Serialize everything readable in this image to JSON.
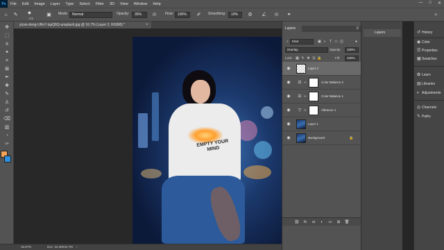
{
  "app": {
    "logo": "Ps"
  },
  "menu": [
    "File",
    "Edit",
    "Image",
    "Layer",
    "Type",
    "Select",
    "Filter",
    "3D",
    "View",
    "Window",
    "Help"
  ],
  "window_controls": {
    "minimize": "—",
    "maximize": "□",
    "close": "✕"
  },
  "options_bar": {
    "brush_size": "175",
    "mode_label": "Mode:",
    "mode_value": "Normal",
    "opacity_label": "Opacity:",
    "opacity_value": "35%",
    "flow_label": "Flow:",
    "flow_value": "100%",
    "smoothing_label": "Smoothing:",
    "smoothing_value": "10%"
  },
  "document_tab": {
    "title": "yican-deng-URn7-lupQ6Q-unsplash.jpg @ 16.7% (Layer 2, RGB/8) *",
    "close": "×"
  },
  "canvas": {
    "shirt_text": "EMPTY YOUR MIND"
  },
  "status_bar": {
    "zoom": "16.67%",
    "doc": "Doc: 34.3M/42.7M",
    "arrow": "›"
  },
  "layers_panel": {
    "tab_label": "Layers",
    "menu_icon": "≡",
    "kind_label": "Kind",
    "blend_mode": "Overlay",
    "opacity_label": "Opacity:",
    "opacity_value": "100%",
    "lock_label": "Lock:",
    "fill_label": "Fill:",
    "fill_value": "100%",
    "layers": [
      {
        "name": "Layer 2",
        "type": "pixel-empty",
        "selected": true
      },
      {
        "name": "Color Balance 2",
        "type": "color-balance"
      },
      {
        "name": "Color Balance 1",
        "type": "color-balance"
      },
      {
        "name": "Vibrance 1",
        "type": "vibrance"
      },
      {
        "name": "Layer 1",
        "type": "pixel-photo"
      },
      {
        "name": "Background",
        "type": "background"
      }
    ],
    "bottom_icons": [
      "link-icon",
      "fx-icon",
      "mask-icon",
      "adjustment-icon",
      "folder-icon",
      "new-layer-icon",
      "trash-icon"
    ],
    "bottom_glyphs": [
      "⛓",
      "fx",
      "◘",
      "◐",
      "▭",
      "⊞",
      "🗑"
    ]
  },
  "mid_panel": {
    "tab_label": "Layers"
  },
  "right_panel": {
    "items": [
      {
        "label": "History",
        "icon": "history-icon",
        "glyph": "↺"
      },
      {
        "label": "Color",
        "icon": "color-icon",
        "glyph": "◉"
      },
      {
        "label": "Properties",
        "icon": "properties-icon",
        "glyph": "☰"
      },
      {
        "label": "Swatches",
        "icon": "swatches-icon",
        "glyph": "▦"
      },
      {
        "label": "Learn",
        "icon": "learn-icon",
        "glyph": "✿"
      },
      {
        "label": "Libraries",
        "icon": "libraries-icon",
        "glyph": "▤"
      },
      {
        "label": "Adjustments",
        "icon": "adjustments-icon",
        "glyph": "◐"
      },
      {
        "label": "Channels",
        "icon": "channels-icon",
        "glyph": "◎"
      },
      {
        "label": "Paths",
        "icon": "paths-icon",
        "glyph": "✎"
      }
    ]
  },
  "colors": {
    "foreground": "#f6a35a",
    "background": "#2d8fe0",
    "ui_bg": "#535353",
    "canvas_bg": "#282828"
  }
}
